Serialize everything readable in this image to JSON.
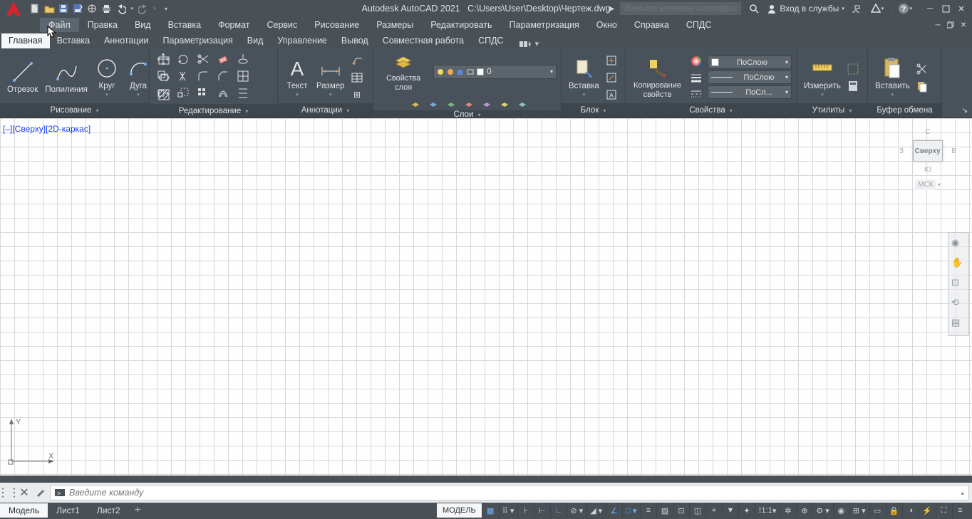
{
  "title": {
    "app": "Autodesk AutoCAD 2021",
    "file": "C:\\Users\\User\\Desktop\\Чертеж.dwg"
  },
  "search": {
    "placeholder": "Введите ключевое слово/фразу"
  },
  "signin": "Вход в службы",
  "menus": [
    "Файл",
    "Правка",
    "Вид",
    "Вставка",
    "Формат",
    "Сервис",
    "Рисование",
    "Размеры",
    "Редактировать",
    "Параметризация",
    "Окно",
    "Справка",
    "СПДС"
  ],
  "ribbon_tabs": [
    "Главная",
    "Вставка",
    "Аннотации",
    "Параметризация",
    "Вид",
    "Управление",
    "Вывод",
    "Совместная работа",
    "СПДС"
  ],
  "panels": {
    "draw": {
      "title": "Рисование",
      "btns": [
        "Отрезок",
        "Полилиния",
        "Круг",
        "Дуга"
      ]
    },
    "modify": {
      "title": "Редактирование"
    },
    "annot": {
      "title": "Аннотации",
      "btns": [
        "Текст",
        "Размер"
      ]
    },
    "layers": {
      "title": "Слои",
      "btn": "Свойства слоя",
      "current": "0"
    },
    "block": {
      "title": "Блок",
      "btn": "Вставка"
    },
    "props": {
      "title": "Свойства",
      "btn": "Копирование свойств",
      "bylayer": "ПоСлою",
      "bylayer2": "ПоСлою",
      "bylayer3": "ПоСл..."
    },
    "utils": {
      "title": "Утилиты",
      "btn": "Измерить"
    },
    "clip": {
      "title": "Буфер обмена",
      "btn": "Вставить"
    }
  },
  "viewport": {
    "label": "[–][Сверху][2D-каркас]",
    "cube": "Сверху",
    "wcs": "МСК",
    "n": "С",
    "s": "Ю",
    "e": "В",
    "w": "З"
  },
  "cmd": {
    "placeholder": "Введите команду"
  },
  "btabs": [
    "Модель",
    "Лист1",
    "Лист2"
  ],
  "status": {
    "model": "МОДЕЛЬ",
    "ratio": "1:1"
  }
}
